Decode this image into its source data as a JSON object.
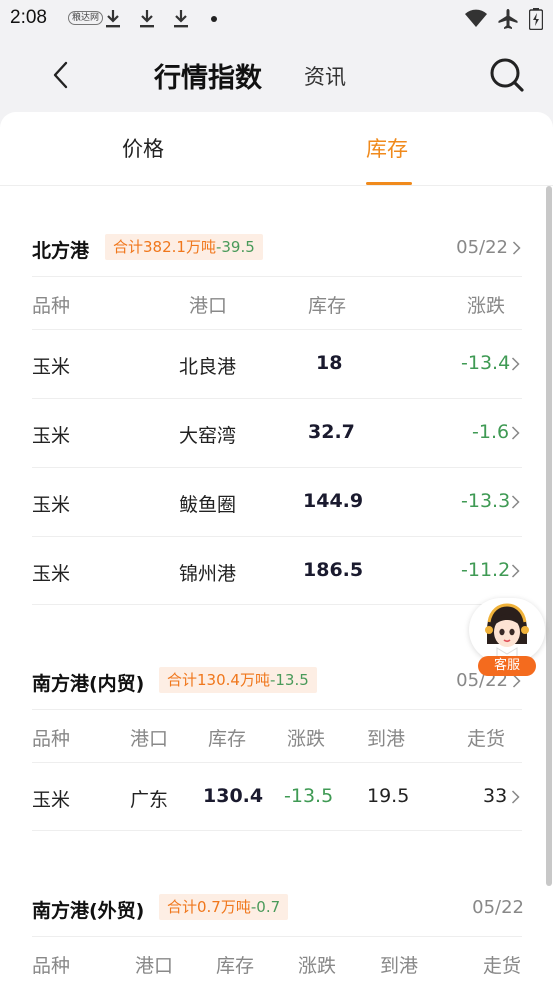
{
  "status_bar": {
    "time": "2:08",
    "logo_text": "粮达网"
  },
  "header": {
    "title": "行情指数",
    "subtitle": "资讯"
  },
  "tabs": [
    {
      "label": "价格",
      "active": false
    },
    {
      "label": "库存",
      "active": true
    }
  ],
  "colors": {
    "accent": "#f08a1c",
    "negative": "#3f9a54",
    "badge_bg": "#fdeee4"
  },
  "sections": [
    {
      "name": "北方港",
      "badge_total": "合计382.1万吨",
      "badge_change": "-39.5",
      "date": "05/22",
      "headers": [
        "品种",
        "港口",
        "库存",
        "涨跌"
      ],
      "rows": [
        [
          "玉米",
          "北良港",
          "18",
          "-13.4"
        ],
        [
          "玉米",
          "大窑湾",
          "32.7",
          "-1.6"
        ],
        [
          "玉米",
          "鲅鱼圈",
          "144.9",
          "-13.3"
        ],
        [
          "玉米",
          "锦州港",
          "186.5",
          "-11.2"
        ]
      ]
    },
    {
      "name": "南方港(内贸)",
      "badge_total": "合计130.4万吨",
      "badge_change": "-13.5",
      "date": "05/22",
      "headers": [
        "品种",
        "港口",
        "库存",
        "涨跌",
        "到港",
        "走货"
      ],
      "rows": [
        [
          "玉米",
          "广东",
          "130.4",
          "-13.5",
          "19.5",
          "33"
        ]
      ]
    },
    {
      "name": "南方港(外贸)",
      "badge_total": "合计0.7万吨",
      "badge_change": "-0.7",
      "date": "05/22",
      "headers": [
        "品种",
        "港口",
        "库存",
        "涨跌",
        "到港",
        "走货"
      ]
    }
  ],
  "service": {
    "label": "客服"
  }
}
